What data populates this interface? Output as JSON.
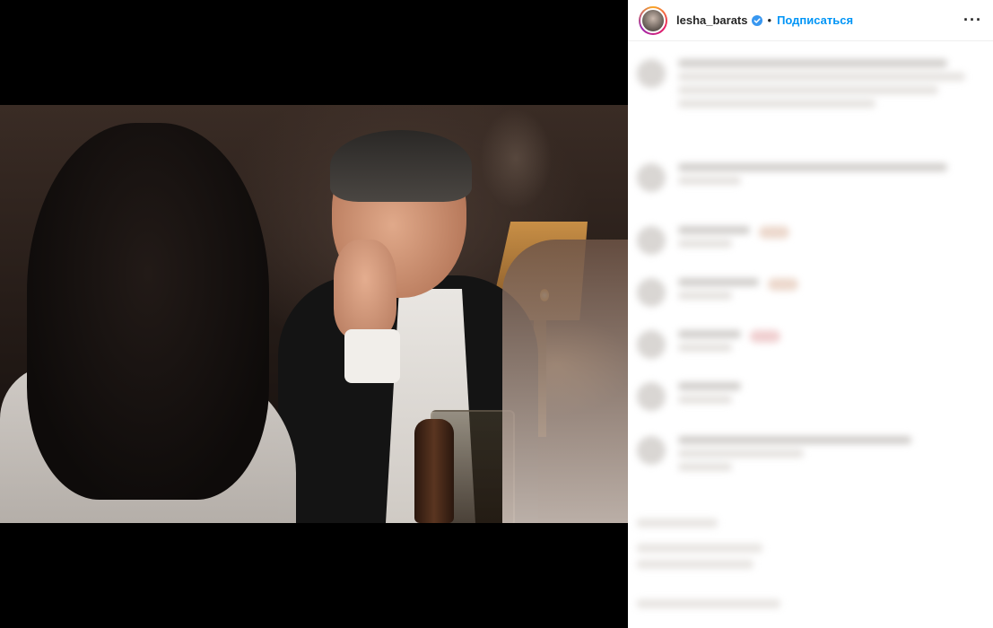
{
  "post": {
    "photo_alt": ""
  },
  "header": {
    "username": "lesha_barats",
    "separator": "•",
    "follow_label": "Подписаться",
    "more_label": "···"
  },
  "colors": {
    "follow": "#0095f6",
    "verified": "#3897f0",
    "text": "#262626"
  }
}
